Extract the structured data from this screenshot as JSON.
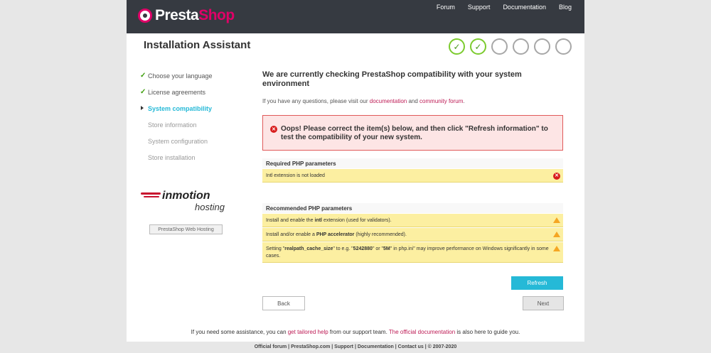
{
  "header": {
    "logo_main": "Presta",
    "logo_accent": "Shop",
    "nav": [
      "Forum",
      "Support",
      "Documentation",
      "Blog"
    ]
  },
  "title": "Installation Assistant",
  "progress": {
    "total_steps": 6,
    "completed_steps": 2,
    "check": "✓"
  },
  "sidebar": {
    "items": [
      {
        "label": "Choose your language",
        "state": "done"
      },
      {
        "label": "License agreements",
        "state": "done"
      },
      {
        "label": "System compatibility",
        "state": "current"
      },
      {
        "label": "Store information",
        "state": "pending"
      },
      {
        "label": "System configuration",
        "state": "pending"
      },
      {
        "label": "Store installation",
        "state": "pending"
      }
    ],
    "check_glyph": "✓",
    "partner_brand": "inmotion",
    "partner_sub": "hosting",
    "partner_button": "PrestaShop Web Hosting"
  },
  "main": {
    "heading": "We are currently checking PrestaShop compatibility with your system environment",
    "intro_prefix": "If you have any questions, please visit our ",
    "intro_link1": "documentation",
    "intro_mid": " and ",
    "intro_link2": "community forum",
    "intro_suffix": ".",
    "error_icon": "✕",
    "error_text": "Oops! Please correct the item(s) below, and then click \"Refresh information\" to test the compatibility of your new system.",
    "required": {
      "title": "Required PHP parameters",
      "rows": [
        {
          "text": "Intl extension is not loaded"
        }
      ]
    },
    "recommended": {
      "title": "Recommended PHP parameters",
      "r1_a": "Install and enable the ",
      "r1_b": "intl",
      "r1_c": " extension (used for validators).",
      "r2_a": "Install and/or enable a ",
      "r2_b": "PHP accelerator",
      "r2_c": " (highly recommended).",
      "r3_a": "Setting \"",
      "r3_b": "realpath_cache_size",
      "r3_c": "\" to e.g. \"",
      "r3_d": "5242880",
      "r3_e": "\" or \"",
      "r3_f": "5M",
      "r3_g": "\" in php.ini\" may improve performance on Windows significantly in some cases."
    },
    "refresh_label": "Refresh",
    "back_label": "Back",
    "next_label": "Next"
  },
  "assist": {
    "prefix": "If you need some assistance, you can ",
    "link1": "get tailored help",
    "mid": " from our support team. ",
    "link2": "The official documentation",
    "suffix": " is also here to guide you."
  },
  "footer": "Official forum | PrestaShop.com | Support | Documentation | Contact us | © 2007-2020"
}
